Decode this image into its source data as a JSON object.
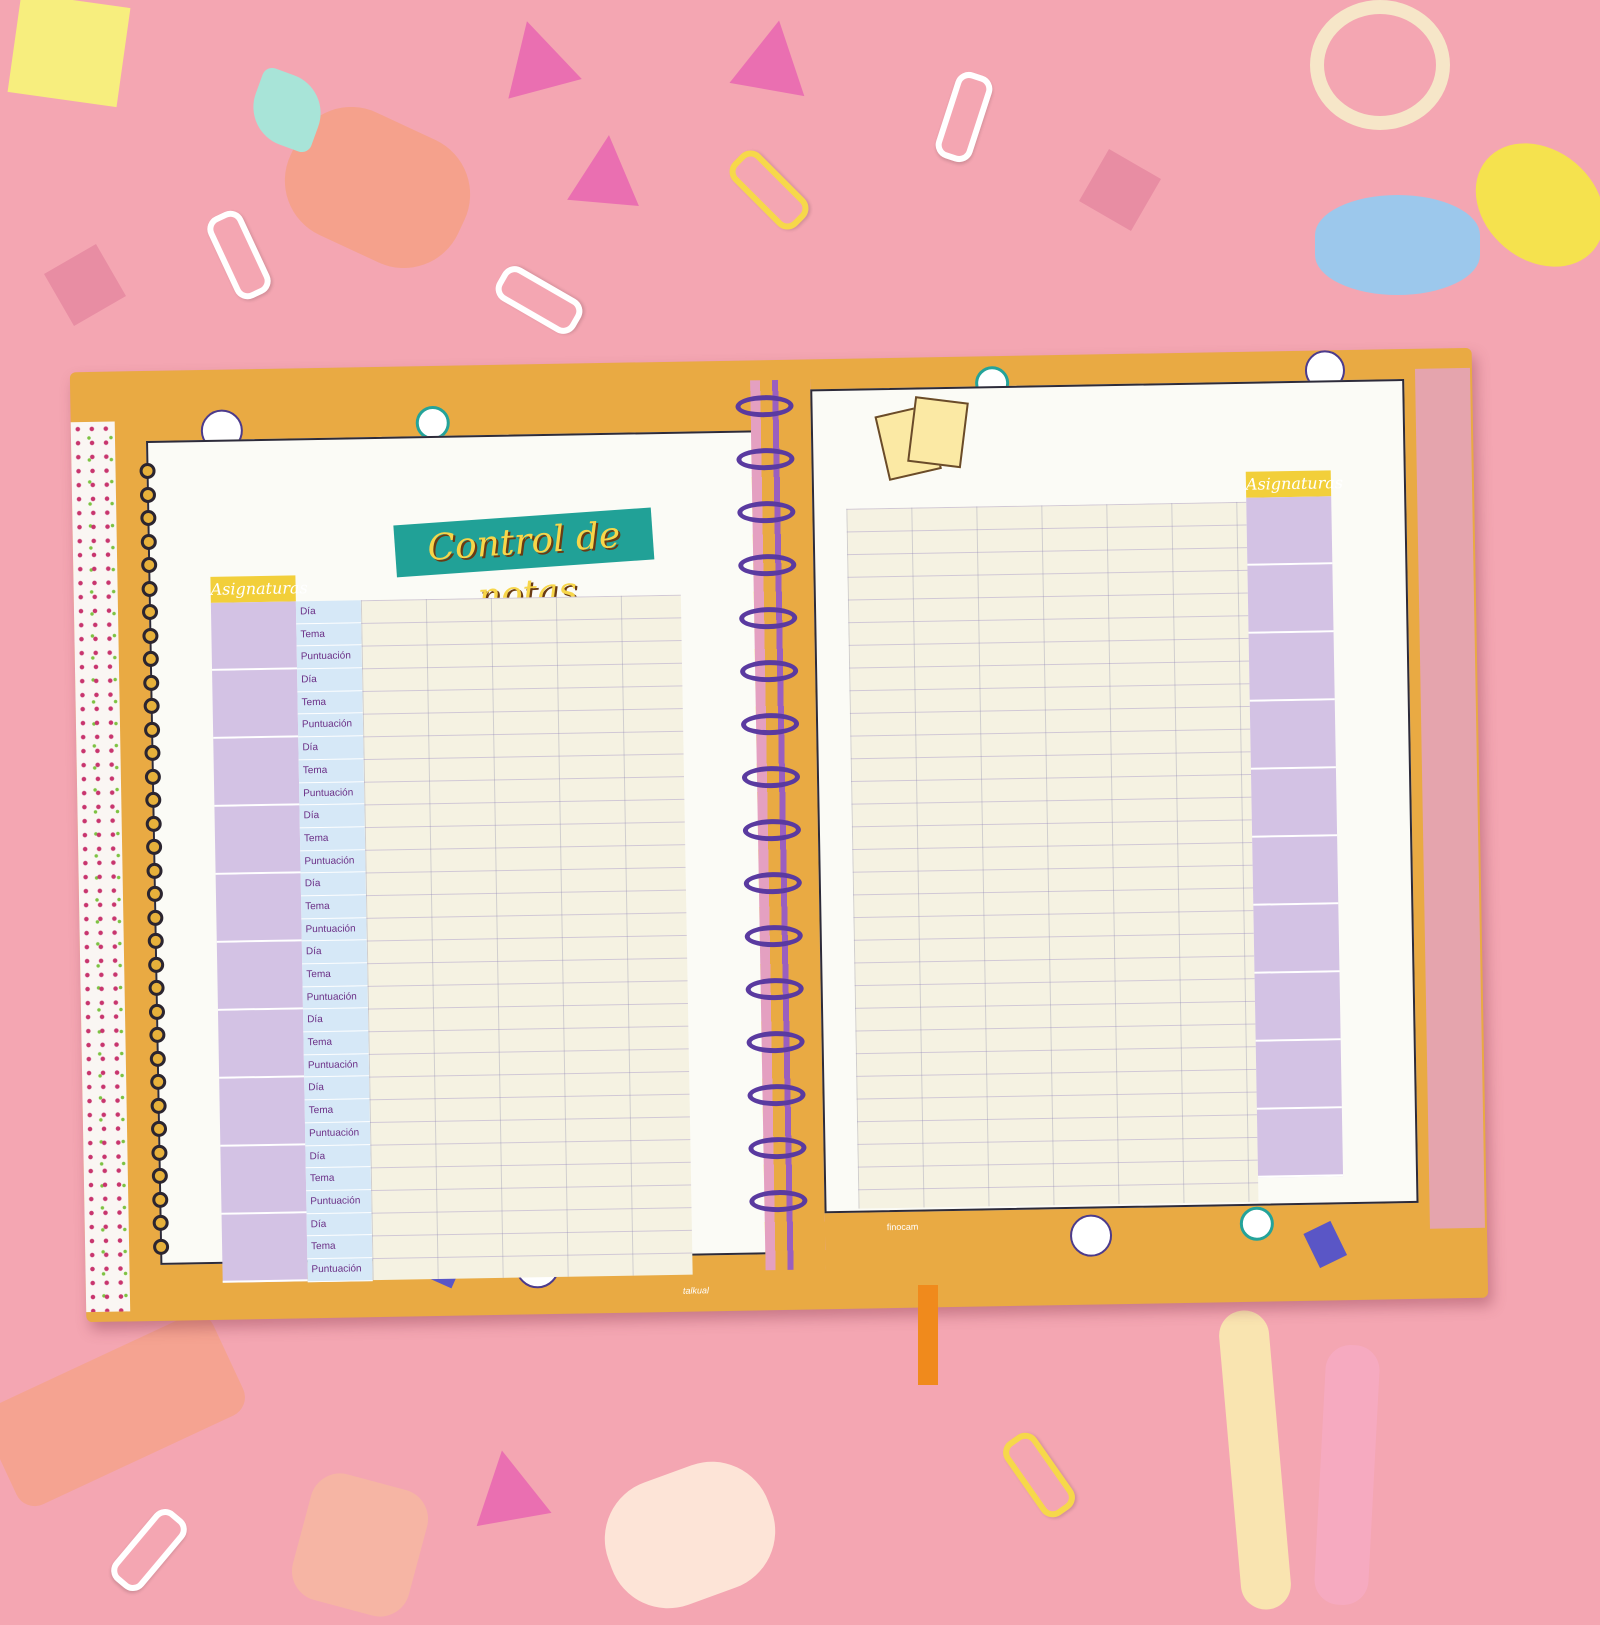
{
  "notebook": {
    "title": "Control de notas",
    "left_page": {
      "subject_header": "Asignaturas",
      "rows": [
        {
          "labels": [
            "Día",
            "Tema",
            "Puntuación"
          ]
        },
        {
          "labels": [
            "Día",
            "Tema",
            "Puntuación"
          ]
        },
        {
          "labels": [
            "Día",
            "Tema",
            "Puntuación"
          ]
        },
        {
          "labels": [
            "Día",
            "Tema",
            "Puntuación"
          ]
        },
        {
          "labels": [
            "Día",
            "Tema",
            "Puntuación"
          ]
        },
        {
          "labels": [
            "Día",
            "Tema",
            "Puntuación"
          ]
        },
        {
          "labels": [
            "Día",
            "Tema",
            "Puntuación"
          ]
        },
        {
          "labels": [
            "Día",
            "Tema",
            "Puntuación"
          ]
        },
        {
          "labels": [
            "Día",
            "Tema",
            "Puntuación"
          ]
        },
        {
          "labels": [
            "Día",
            "Tema",
            "Puntuación"
          ]
        }
      ]
    },
    "right_page": {
      "subject_header": "Asignaturas"
    },
    "brands": {
      "left": "talkual",
      "right": "finocam"
    },
    "colors": {
      "cover": "#e9aa43",
      "title_bg": "#21a197",
      "title_text": "#f7d64a",
      "subject_fill": "#d3c2e4",
      "label_fill": "#d6e8f7",
      "grid_fill": "#f5f2e2",
      "rings": "#5a3aa0",
      "background": "#f4a6b2"
    }
  }
}
